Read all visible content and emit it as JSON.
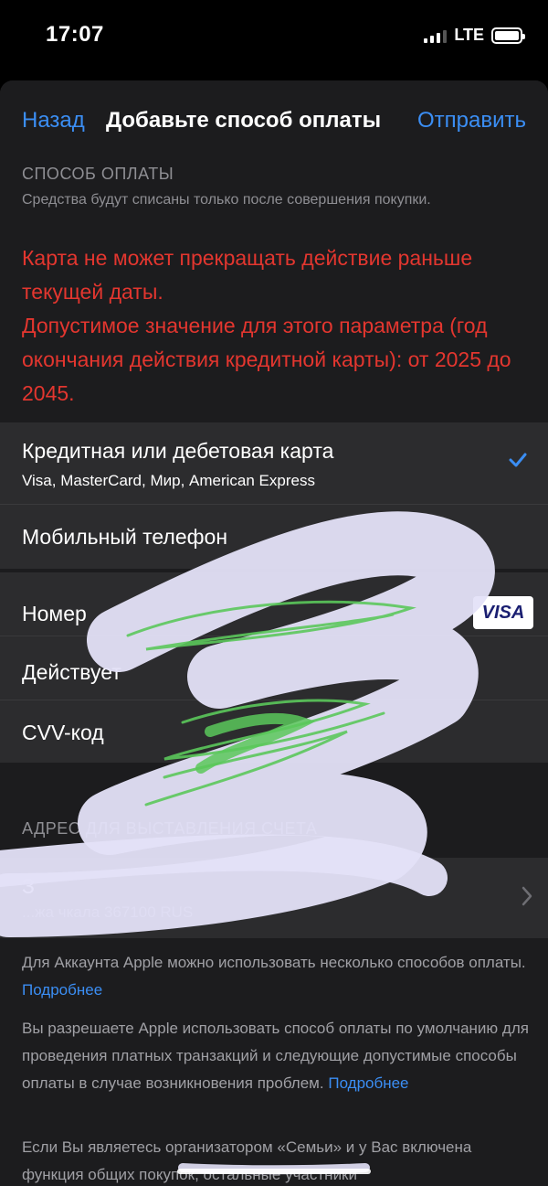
{
  "status": {
    "time": "17:07",
    "network": "LTE"
  },
  "nav": {
    "back": "Назад",
    "title": "Добавьте способ оплаты",
    "send": "Отправить"
  },
  "payment": {
    "header": "СПОСОБ ОПЛАТЫ",
    "subheader": "Средства будут списаны только после совершения покупки.",
    "error": "Карта не может прекращать действие раньше текущей даты.\nДопустимое значение для этого параметра (год окончания действия кредитной карты): от 2025 до 2045.",
    "methods": [
      {
        "title": "Кредитная или дебетовая карта",
        "subtitle": "Visa, MasterCard, Мир, American Express",
        "selected": true
      },
      {
        "title": "Мобильный телефон"
      }
    ]
  },
  "card": {
    "number_label": "Номер",
    "expiry_label": "Действует",
    "cvv_label": "CVV-код",
    "brand": "VISA"
  },
  "address": {
    "header": "АДРЕС ДЛЯ ВЫСТАВЛЕНИЯ СЧЕТА",
    "name": "З",
    "value": "...жа чкала 367100 RUS"
  },
  "footer": {
    "p1": "Для Аккаунта Apple можно использовать несколько способов оплаты.",
    "p1_link": "Подробнее",
    "p2": "Вы разрешаете Apple использовать способ оплаты по умолчанию для проведения платных транзакций и следующие допустимые способы оплаты в случае возникновения проблем.",
    "p2_link": "Подробнее",
    "p3": "Если Вы являетесь организатором «Семьи» и у Вас включена функция общих покупок, остальные участники"
  },
  "colors": {
    "accent": "#3b8ef4",
    "error": "#e3362f",
    "background": "#1c1c1e",
    "cell": "#2c2c2e"
  }
}
